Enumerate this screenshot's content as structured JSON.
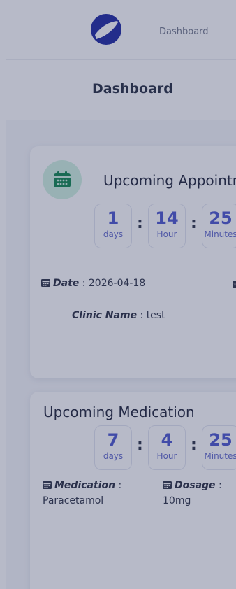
{
  "nav": {
    "link_label": "Dashboard"
  },
  "header": {
    "title": "Dashboard"
  },
  "appointment": {
    "title": "Upcoming Appointment",
    "countdown": [
      {
        "value": "1",
        "unit": "days"
      },
      {
        "value": "14",
        "unit": "Hour"
      },
      {
        "value": "25",
        "unit": "Minutes"
      }
    ],
    "date_label": "Date",
    "date_value": "2026-04-18",
    "clinic_label": "Clinic Name",
    "clinic_value": "test"
  },
  "medication": {
    "title": "Upcoming Medication",
    "countdown": [
      {
        "value": "7",
        "unit": "days"
      },
      {
        "value": "4",
        "unit": "Hour"
      },
      {
        "value": "25",
        "unit": "Minutes"
      }
    ],
    "medication_label": "Medication",
    "medication_value": "Paracetamol",
    "dosage_label": "Dosage",
    "dosage_value": "10mg"
  },
  "colors": {
    "accent": "#5661d2",
    "icon_bg": "#d3f3e3",
    "icon_fg": "#1e8f5a",
    "overlay": "#121948"
  },
  "icons": {
    "logo": "app-logo",
    "appointment": "calendar-icon",
    "info": "calendar-small-icon"
  }
}
